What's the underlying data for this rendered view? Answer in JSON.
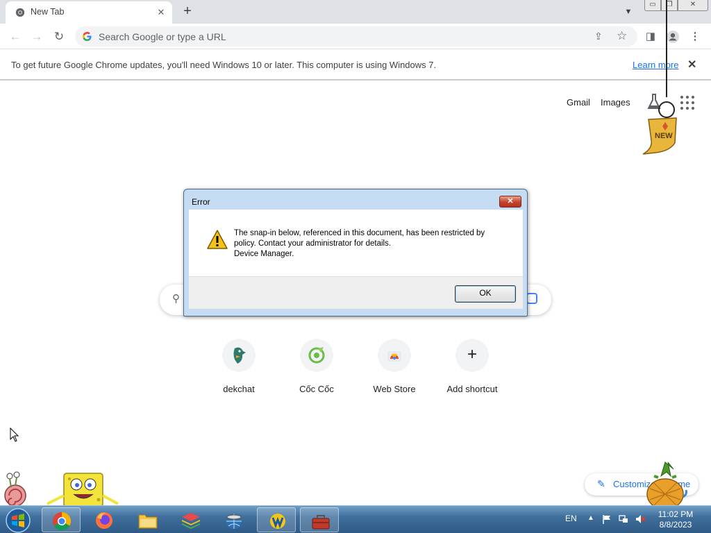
{
  "tab": {
    "title": "New Tab"
  },
  "window_controls": {
    "minimize": "▭",
    "maximize": "❐",
    "close": "✕"
  },
  "toolbar": {
    "omnibox_placeholder": "Search Google or type a URL"
  },
  "infobar": {
    "message": "To get future Google Chrome updates, you'll need Windows 10 or later. This computer is using Windows 7.",
    "link": "Learn more"
  },
  "ntp": {
    "top_links": {
      "gmail": "Gmail",
      "images": "Images"
    },
    "sticker_text": "NEW",
    "shortcuts": [
      {
        "label": "dekchat"
      },
      {
        "label": "Cốc Cốc"
      },
      {
        "label": "Web Store"
      },
      {
        "label": "Add shortcut"
      }
    ],
    "customize_label": "Customize Chrome"
  },
  "dialog": {
    "title": "Error",
    "message_line1": "The snap-in below, referenced in this document, has been restricted by",
    "message_line2": "policy. Contact your administrator for details.",
    "message_line3": "Device Manager.",
    "ok_label": "OK"
  },
  "taskbar": {
    "language": "EN",
    "time": "11:02 PM",
    "date": "8/8/2023",
    "apps": [
      "chrome",
      "firefox",
      "file-explorer",
      "bluestacks",
      "internet-download-manager",
      "ultraviewer",
      "toolbox"
    ]
  }
}
